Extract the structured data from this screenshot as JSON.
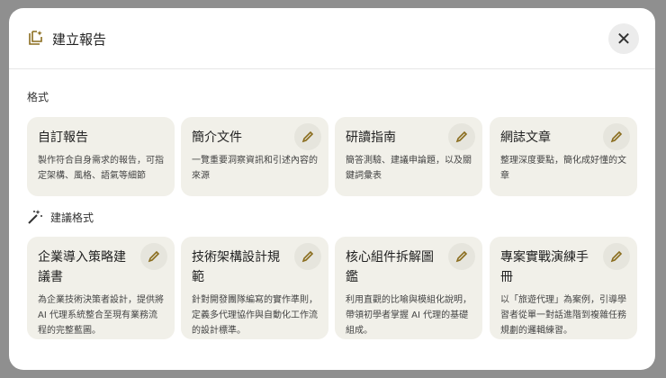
{
  "dialog": {
    "title": "建立報告",
    "close_label": "✕"
  },
  "formats": {
    "label": "格式",
    "cards": [
      {
        "title": "自訂報告",
        "desc": "製作符合自身需求的報告，可指定架構、風格、語氣等細節",
        "editable": false
      },
      {
        "title": "簡介文件",
        "desc": "一覽重要洞察資訊和引述內容的來源",
        "editable": true
      },
      {
        "title": "研讀指南",
        "desc": "簡答測驗、建議申論題，以及關鍵詞彙表",
        "editable": true
      },
      {
        "title": "網誌文章",
        "desc": "整理深度要點，簡化成好懂的文章",
        "editable": true
      }
    ]
  },
  "suggested": {
    "label": "建議格式",
    "cards": [
      {
        "title": "企業導入策略建議書",
        "desc": "為企業技術決策者設計，提供將 AI 代理系統整合至現有業務流程的完整藍圖。"
      },
      {
        "title": "技術架構設計規範",
        "desc": "針對開發團隊編寫的實作準則，定義多代理協作與自動化工作流的設計標準。"
      },
      {
        "title": "核心組件拆解圖鑑",
        "desc": "利用直觀的比喻與模組化說明，帶領初學者掌握 AI 代理的基礎組成。"
      },
      {
        "title": "專案實戰演練手冊",
        "desc": "以「旅遊代理」為案例，引導學習者從單一對話進階到複雜任務規劃的邏輯練習。"
      }
    ]
  },
  "colors": {
    "accent": "#8a6d1e",
    "card": "#f1f0e9"
  }
}
